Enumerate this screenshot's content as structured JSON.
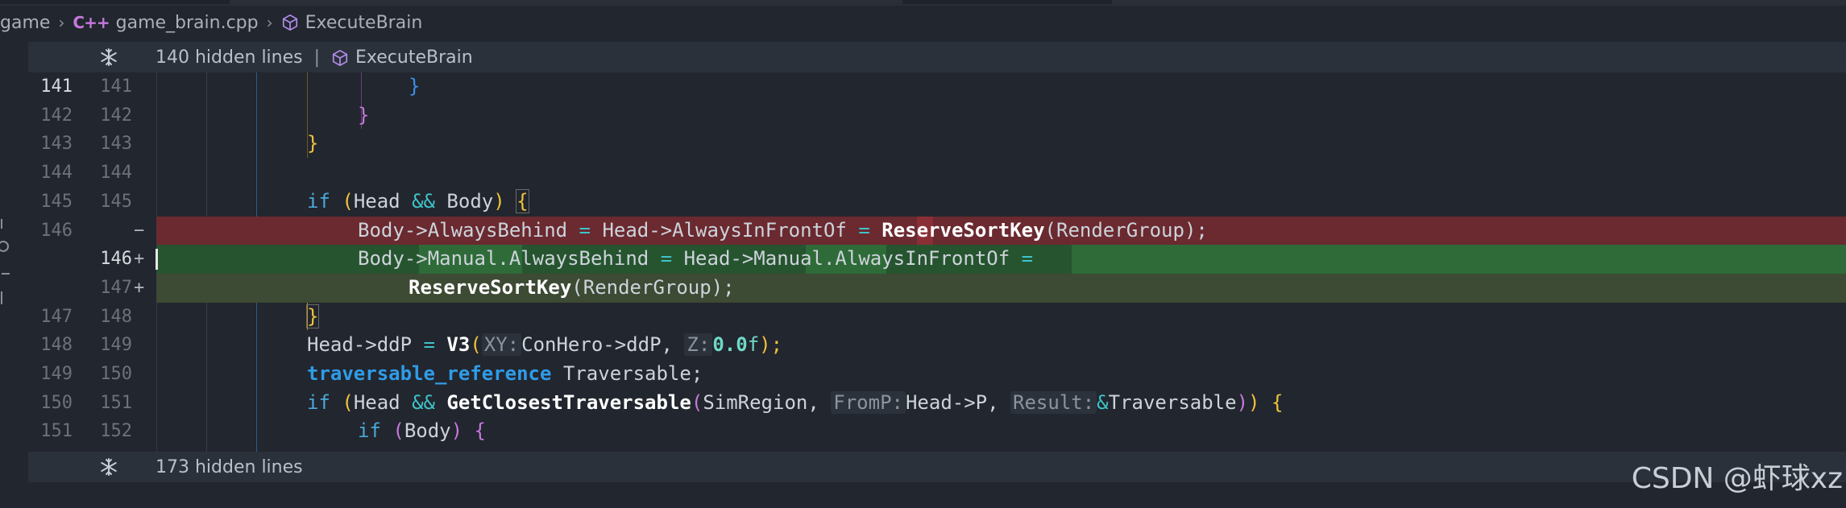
{
  "breadcrumb": {
    "items": [
      "game",
      "game_brain.cpp",
      "ExecuteBrain"
    ],
    "cpp_badge": "C++"
  },
  "folds": {
    "top": {
      "count_label": "140 hidden lines",
      "separator": "|",
      "symbol": "ExecuteBrain"
    },
    "bottom": {
      "count_label": "173 hidden lines"
    }
  },
  "lines": [
    {
      "left": "141",
      "right": "141",
      "mark": "",
      "kind": "normal"
    },
    {
      "left": "142",
      "right": "142",
      "mark": "",
      "kind": "normal"
    },
    {
      "left": "143",
      "right": "143",
      "mark": "",
      "kind": "normal"
    },
    {
      "left": "144",
      "right": "144",
      "mark": "",
      "kind": "normal"
    },
    {
      "left": "145",
      "right": "145",
      "mark": "",
      "kind": "normal"
    },
    {
      "left": "146",
      "right": "",
      "mark": "−",
      "kind": "deleted"
    },
    {
      "left": "",
      "right": "146",
      "mark": "+",
      "kind": "added"
    },
    {
      "left": "",
      "right": "147",
      "mark": "+",
      "kind": "added"
    },
    {
      "left": "147",
      "right": "148",
      "mark": "",
      "kind": "normal"
    },
    {
      "left": "148",
      "right": "149",
      "mark": "",
      "kind": "normal"
    },
    {
      "left": "149",
      "right": "150",
      "mark": "",
      "kind": "normal"
    },
    {
      "left": "150",
      "right": "151",
      "mark": "",
      "kind": "normal"
    },
    {
      "left": "151",
      "right": "152",
      "mark": "",
      "kind": "normal"
    }
  ],
  "code": {
    "l141": "}",
    "l142": "}",
    "l143": "}",
    "l145": {
      "if": "if",
      "open": "(",
      "a": "Head",
      "and": "&&",
      "b": "Body",
      "close": ")",
      "brace": "{"
    },
    "l146_del": {
      "lhs": "Body->AlwaysBehind",
      "eq": "=",
      "rhs": "Head->AlwaysInFrontOf",
      "eq2": "=",
      "fn": "ReserveSortKey",
      "args": "(RenderGroup);"
    },
    "l146_add": {
      "lhs": "Body->Manual.AlwaysBehind",
      "eq": "=",
      "rhs": "Head->Manual.AlwaysInFrontOf",
      "eq2": "="
    },
    "l147_add": {
      "fn": "ReserveSortKey",
      "args": "(RenderGroup);"
    },
    "l148": "}",
    "l149": {
      "lhs": "Head->ddP",
      "eq": "=",
      "fn": "V3",
      "open": "(",
      "hint1": "XY:",
      "arg1": "ConHero->ddP,",
      "hint2": "Z:",
      "num": "0.0",
      "suffix": "f",
      "close": ");"
    },
    "l150": {
      "type": "traversable_reference",
      "name": "Traversable;"
    },
    "l151": {
      "if": "if",
      "open": "(",
      "a": "Head",
      "and": "&&",
      "fn": "GetClosestTraversable",
      "popen": "(",
      "arg1": "SimRegion,",
      "hint1": "FromP:",
      "arg2": "Head->P,",
      "hint2": "Result:",
      "amp": "&",
      "arg3": "Traversable",
      "pclose": ")",
      "close": ")",
      "brace": "{"
    },
    "l152": {
      "if": "if",
      "open": "(",
      "a": "Body",
      "close": ")",
      "brace": "{"
    }
  },
  "watermark": "CSDN @虾球xz",
  "colors": {
    "background": "#22262e",
    "deleted_line": "#6a2a30",
    "added_line": "#26542f",
    "keyword": "#4aa8d9",
    "bracket_gold": "#f0c33c",
    "bracket_purple": "#c678dd",
    "bracket_blue": "#3c8fe8"
  }
}
